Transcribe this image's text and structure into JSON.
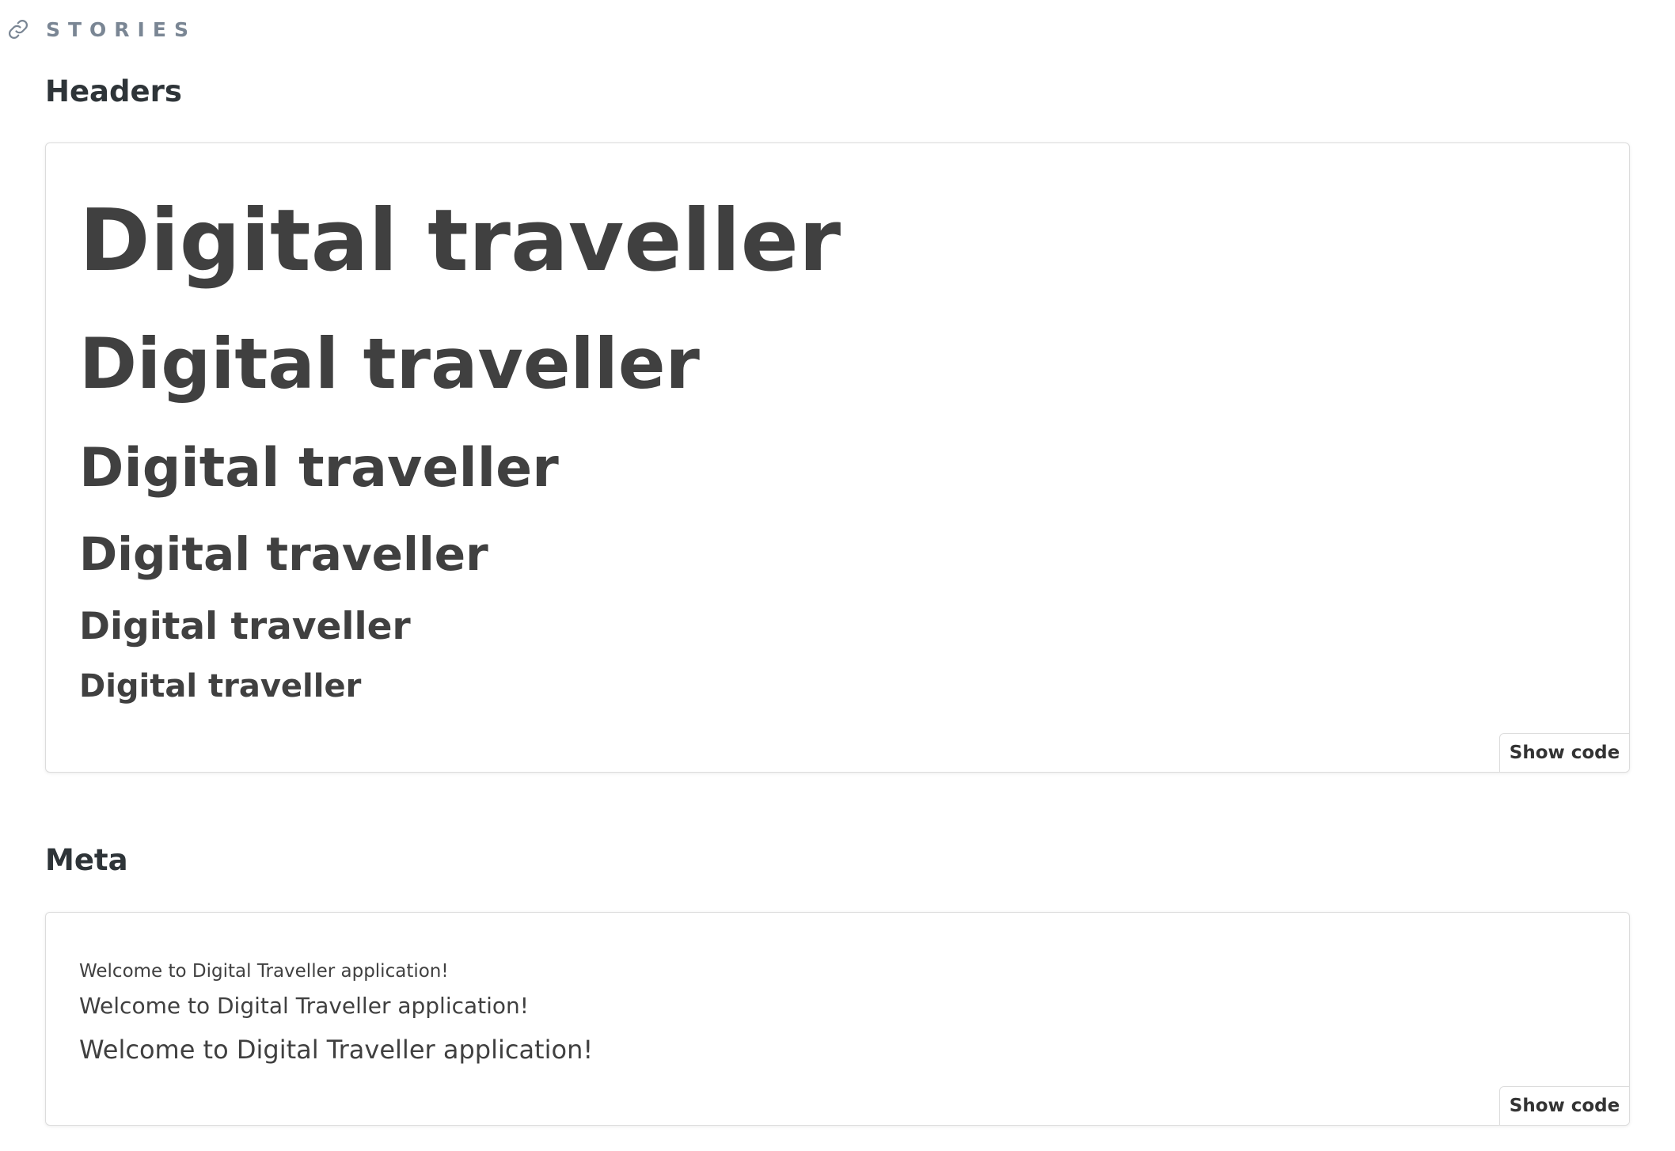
{
  "header": {
    "label": "STORIES",
    "icon": "link-icon"
  },
  "sections": [
    {
      "title": "Headers",
      "headings": [
        "Digital traveller",
        "Digital traveller",
        "Digital traveller",
        "Digital traveller",
        "Digital traveller",
        "Digital traveller"
      ],
      "show_code_label": "Show code"
    },
    {
      "title": "Meta",
      "lines": [
        "Welcome to Digital Traveller application!",
        "Welcome to Digital Traveller application!",
        "Welcome to Digital Traveller application!"
      ],
      "show_code_label": "Show code"
    }
  ],
  "colors": {
    "label": "#7a8694",
    "text": "#404040",
    "border": "#dcdcdc"
  }
}
